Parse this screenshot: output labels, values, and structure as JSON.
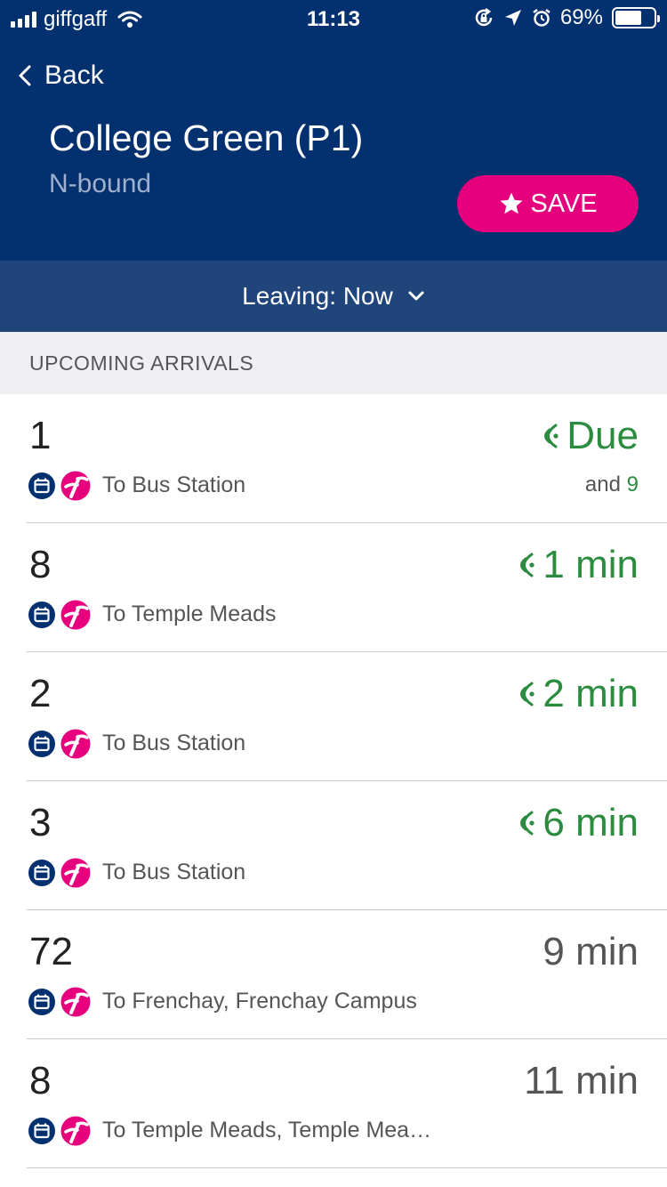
{
  "status_bar": {
    "carrier": "giffgaff",
    "time": "11:13",
    "battery": "69%",
    "battery_level": 0.69
  },
  "nav": {
    "back_label": "Back"
  },
  "stop": {
    "title": "College Green (P1)",
    "direction": "N-bound",
    "save_label": "SAVE"
  },
  "leaving": {
    "label": "Leaving: Now"
  },
  "section": {
    "title": "UPCOMING ARRIVALS"
  },
  "colors": {
    "header": "#03306e",
    "leaving_bar": "#20457b",
    "accent": "#e6007e",
    "live": "#2b8b3e"
  },
  "arrivals": [
    {
      "route": "1",
      "destination": "To Bus Station",
      "time": "Due",
      "realtime": true,
      "also_prefix": "and",
      "also_value": "9"
    },
    {
      "route": "8",
      "destination": "To Temple Meads",
      "time": "1 min",
      "realtime": true
    },
    {
      "route": "2",
      "destination": "To Bus Station",
      "time": "2 min",
      "realtime": true
    },
    {
      "route": "3",
      "destination": "To Bus Station",
      "time": "6 min",
      "realtime": true
    },
    {
      "route": "72",
      "destination": "To Frenchay, Frenchay Campus",
      "time": "9 min",
      "realtime": false
    },
    {
      "route": "8",
      "destination": "To Temple Meads, Temple Mea…",
      "time": "11 min",
      "realtime": false
    }
  ]
}
